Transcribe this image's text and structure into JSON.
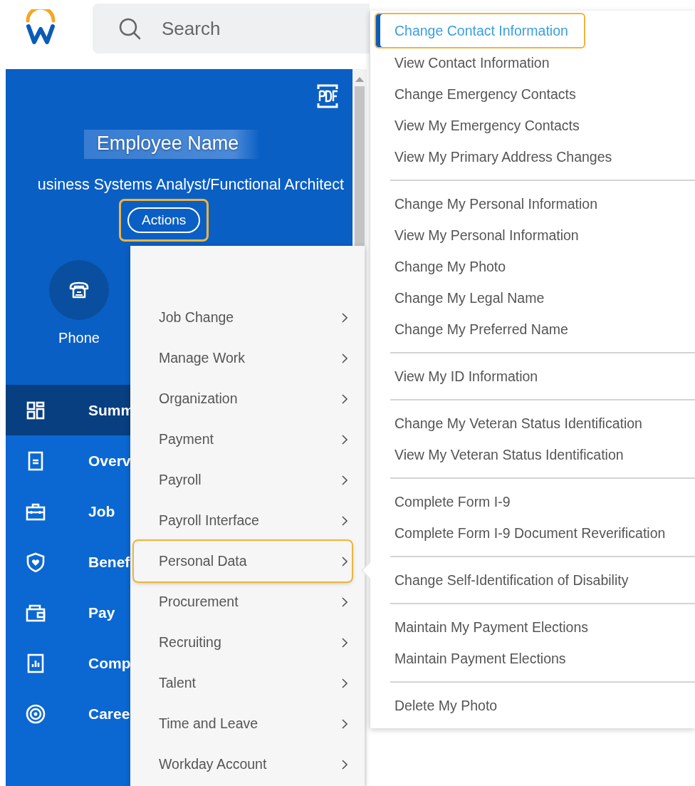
{
  "search": {
    "placeholder": "Search"
  },
  "profile": {
    "name": "Employee Name",
    "title": "usiness Systems Analyst/Functional Architect",
    "actions_button": {
      "label": "Actions",
      "highlighted": true
    },
    "contacts": [
      {
        "label": "Phone"
      }
    ]
  },
  "nav": [
    {
      "label": "Summ",
      "selected": true
    },
    {
      "label": "Overv",
      "selected": false
    },
    {
      "label": "Job",
      "selected": false
    },
    {
      "label": "Benef",
      "selected": false
    },
    {
      "label": "Pay",
      "selected": false
    },
    {
      "label": "Comp",
      "selected": false
    },
    {
      "label": "Caree",
      "selected": false
    }
  ],
  "actions_menu": {
    "items": [
      {
        "label": "Job Change",
        "selected": false
      },
      {
        "label": "Manage Work",
        "selected": false
      },
      {
        "label": "Organization",
        "selected": false
      },
      {
        "label": "Payment",
        "selected": false
      },
      {
        "label": "Payroll",
        "selected": false
      },
      {
        "label": "Payroll Interface",
        "selected": false
      },
      {
        "label": "Personal Data",
        "selected": true
      },
      {
        "label": "Procurement",
        "selected": false
      },
      {
        "label": "Recruiting",
        "selected": false
      },
      {
        "label": "Talent",
        "selected": false
      },
      {
        "label": "Time and Leave",
        "selected": false
      },
      {
        "label": "Workday Account",
        "selected": false
      }
    ]
  },
  "submenu": {
    "groups": [
      [
        {
          "label": "Change Contact Information",
          "selected": true
        },
        {
          "label": "View Contact Information",
          "selected": false
        },
        {
          "label": "Change Emergency Contacts",
          "selected": false
        },
        {
          "label": "View My Emergency Contacts",
          "selected": false
        },
        {
          "label": "View My Primary Address Changes",
          "selected": false
        }
      ],
      [
        {
          "label": "Change My Personal Information",
          "selected": false
        },
        {
          "label": "View My Personal Information",
          "selected": false
        },
        {
          "label": "Change My Photo",
          "selected": false
        },
        {
          "label": "Change My Legal Name",
          "selected": false
        },
        {
          "label": "Change My Preferred Name",
          "selected": false
        }
      ],
      [
        {
          "label": "View My ID Information",
          "selected": false
        }
      ],
      [
        {
          "label": "Change My Veteran Status Identification",
          "selected": false
        },
        {
          "label": "View My Veteran Status Identification",
          "selected": false
        }
      ],
      [
        {
          "label": "Complete Form I-9",
          "selected": false
        },
        {
          "label": "Complete Form I-9 Document Reverification",
          "selected": false
        }
      ],
      [
        {
          "label": "Change Self-Identification of Disability",
          "selected": false
        }
      ],
      [
        {
          "label": "Maintain My Payment Elections",
          "selected": false
        },
        {
          "label": "Maintain Payment Elections",
          "selected": false
        }
      ],
      [
        {
          "label": "Delete My Photo",
          "selected": false
        }
      ]
    ]
  }
}
